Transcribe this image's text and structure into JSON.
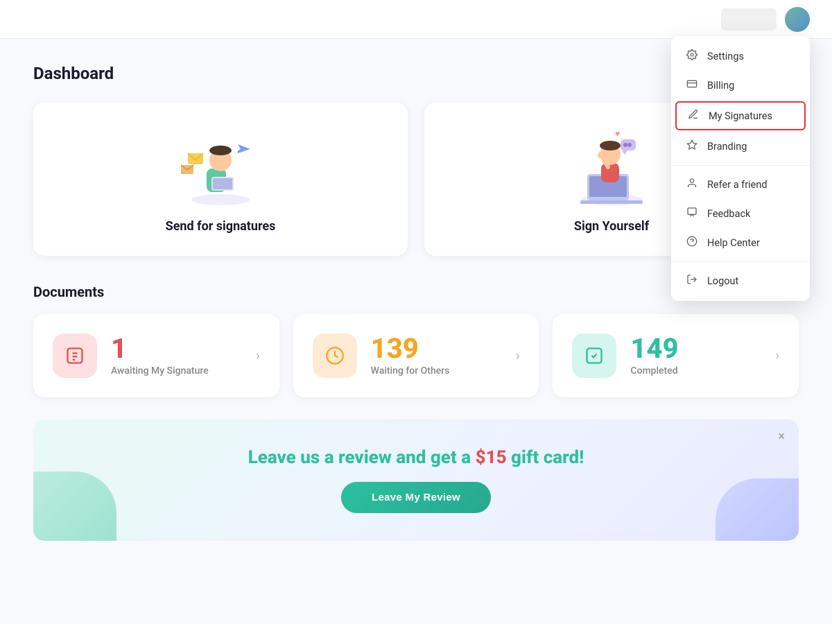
{
  "header": {
    "avatar_alt": "User Avatar"
  },
  "page": {
    "title": "Dashboard"
  },
  "action_cards": [
    {
      "id": "send-signatures",
      "title": "Send for signatures"
    },
    {
      "id": "sign-yourself",
      "title": "Sign Yourself"
    }
  ],
  "documents": {
    "section_title": "Documents",
    "stats": [
      {
        "id": "awaiting",
        "number": "1",
        "label": "Awaiting My Signature",
        "color": "red",
        "icon": "📋"
      },
      {
        "id": "waiting",
        "number": "139",
        "label": "Waiting for Others",
        "color": "orange",
        "icon": "🕐"
      },
      {
        "id": "completed",
        "number": "149",
        "label": "Completed",
        "color": "teal",
        "icon": "✅"
      }
    ]
  },
  "review_banner": {
    "text_prefix": "Leave us a review and get a ",
    "amount": "$15",
    "text_suffix": " gift card!",
    "button_label": "Leave My Review",
    "close_label": "×"
  },
  "dropdown": {
    "items": [
      {
        "id": "settings",
        "label": "Settings",
        "icon": "⚙️"
      },
      {
        "id": "billing",
        "label": "Billing",
        "icon": "🧾"
      },
      {
        "id": "my-signatures",
        "label": "My Signatures",
        "icon": "✒️",
        "highlighted": true
      },
      {
        "id": "branding",
        "label": "Branding",
        "icon": "👑"
      },
      {
        "id": "refer-friend",
        "label": "Refer a friend",
        "icon": "👤",
        "divider_before": true
      },
      {
        "id": "feedback",
        "label": "Feedback",
        "icon": "💬"
      },
      {
        "id": "help-center",
        "label": "Help Center",
        "icon": "ℹ️"
      },
      {
        "id": "logout",
        "label": "Logout",
        "icon": "🚪",
        "divider_before": true
      }
    ]
  }
}
